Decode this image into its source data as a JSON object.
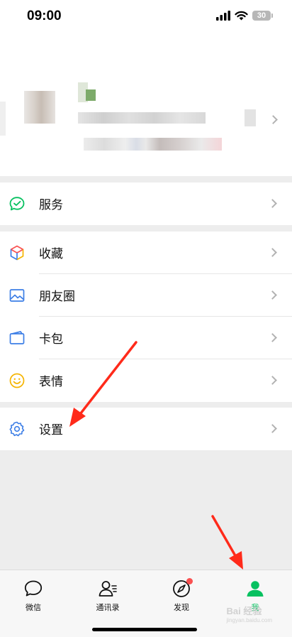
{
  "status_bar": {
    "time": "09:00",
    "battery": "30",
    "icons": [
      "signal-icon",
      "wifi-icon",
      "battery-icon"
    ]
  },
  "profile": {
    "blurred": true,
    "chevron": "chevron-right-icon"
  },
  "menu": {
    "services": {
      "label": "服务",
      "icon": "services-icon"
    },
    "favorites": {
      "label": "收藏",
      "icon": "favorites-icon"
    },
    "moments": {
      "label": "朋友圈",
      "icon": "moments-icon"
    },
    "cards": {
      "label": "卡包",
      "icon": "card-wallet-icon"
    },
    "stickers": {
      "label": "表情",
      "icon": "sticker-face-icon"
    },
    "settings": {
      "label": "设置",
      "icon": "gear-icon"
    }
  },
  "tabbar": {
    "tabs": [
      {
        "label": "微信",
        "icon": "chat-bubble-icon",
        "active": false
      },
      {
        "label": "通讯录",
        "icon": "contacts-icon",
        "active": false
      },
      {
        "label": "发现",
        "icon": "compass-icon",
        "active": false,
        "badge": "dot"
      },
      {
        "label": "我",
        "icon": "person-icon",
        "active": true
      }
    ]
  },
  "colors": {
    "accent": "#07c160",
    "badge": "#fa5151",
    "background": "#ededed",
    "annotation_arrow": "#ff2a1a"
  },
  "watermark": {
    "brand": "Bai 经验",
    "sub": "jingyan.baidu.com"
  }
}
